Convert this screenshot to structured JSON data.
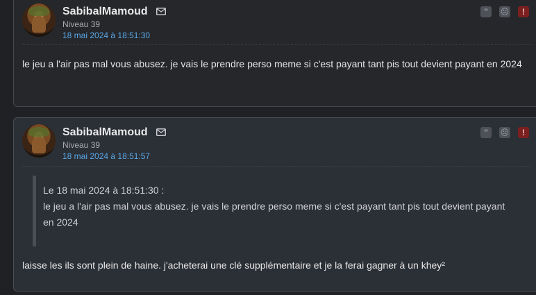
{
  "posts": [
    {
      "author": "SabibalMamoud",
      "level": "Niveau 39",
      "date": "18 mai 2024 à 18:51:30",
      "message": "le jeu a l'air pas mal vous abusez. je vais le prendre perso meme si c'est payant tant pis tout devient payant en 2024",
      "actions": {
        "quote": "”",
        "mp": "☹",
        "alert": "!"
      }
    },
    {
      "author": "SabibalMamoud",
      "level": "Niveau 39",
      "date": "18 mai 2024 à 18:51:57",
      "quote": {
        "header": "Le 18 mai 2024 à 18:51:30 :",
        "text": "le jeu a l'air pas mal vous abusez. je vais le prendre perso meme si c'est payant tant pis tout devient payant en 2024"
      },
      "message": "laisse les ils sont plein de haine. j'acheterai une clé supplémentaire et je la ferai gagner à un khey²",
      "actions": {
        "quote": "”",
        "mp": "☹",
        "alert": "!"
      }
    }
  ],
  "colors": {
    "date_link": "#5aa7e6",
    "alert": "#7b1f1f",
    "background": "#202124"
  }
}
